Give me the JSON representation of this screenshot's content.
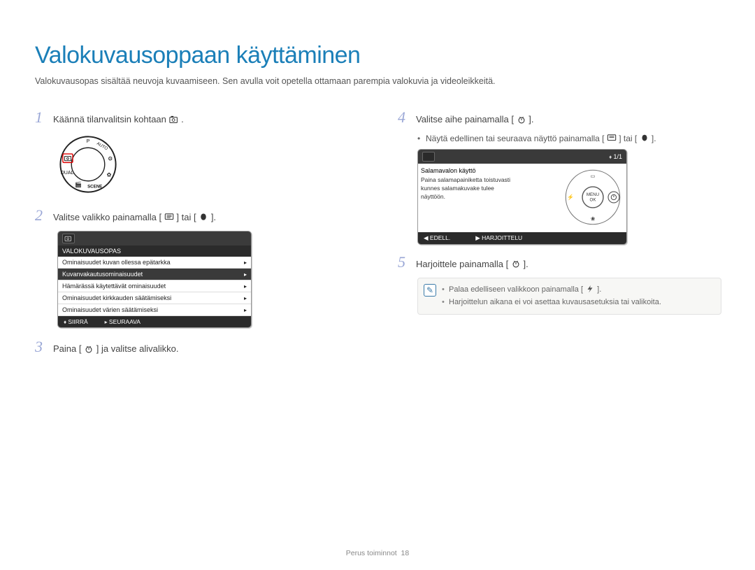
{
  "page": {
    "title": "Valokuvausoppaan käyttäminen",
    "intro": "Valokuvausopas sisältää neuvoja kuvaamiseen. Sen avulla voit opetella ottamaan parempia valokuvia ja videoleikkeitä."
  },
  "steps": {
    "s1": {
      "num": "1",
      "text_before": "Käännä tilanvalitsin kohtaan ",
      "text_after": "."
    },
    "s2": {
      "num": "2",
      "text_before": "Valitse valikko painamalla [",
      "text_mid": "] tai [",
      "text_after": "]."
    },
    "s3": {
      "num": "3",
      "text": "Paina [",
      "text_after": "] ja valitse alivalikko."
    },
    "s4": {
      "num": "4",
      "text": "Valitse aihe painamalla [",
      "text_after": "]."
    },
    "s4_bullet": {
      "pre": "Näytä edellinen tai seuraava näyttö painamalla [",
      "mid": "] tai [",
      "post": "]."
    },
    "s5": {
      "num": "5",
      "text": "Harjoittele painamalla [",
      "text_after": "]."
    }
  },
  "menu_screen": {
    "title": "VALOKUVAUSOPAS",
    "rows": [
      "Ominaisuudet kuvan ollessa epätarkka",
      "Kuvanvakautusominaisuudet",
      "Hämärässä käytettävät ominaisuudet",
      "Ominaisuudet kirkkauden säätämiseksi",
      "Ominaisuudet värien säätämiseksi"
    ],
    "selected_index": 1,
    "footer_left": "SIIRRÄ",
    "footer_right": "SEURAAVA"
  },
  "detail_screen": {
    "page_indicator": "1/1",
    "heading": "Salamavalon käyttö",
    "body_line1": "Paina salamapainiketta toistuvasti",
    "body_line2": "kunnes salamakuvake tulee",
    "body_line3": "näyttöön.",
    "footer_left": "EDELL.",
    "footer_right": "HARJOITTELU"
  },
  "infobox": {
    "line1_pre": "Palaa edelliseen valikkoon painamalla [",
    "line1_post": "].",
    "line2": "Harjoittelun aikana ei voi asettaa kuvausasetuksia tai valikoita."
  },
  "footer": {
    "section": "Perus toiminnot",
    "page": "18"
  },
  "icons": {
    "guide_mode": "guide-mode-icon",
    "disp": "disp-button-icon",
    "macro": "macro-button-icon",
    "timer": "self-timer-button-icon",
    "flash": "flash-button-icon"
  }
}
